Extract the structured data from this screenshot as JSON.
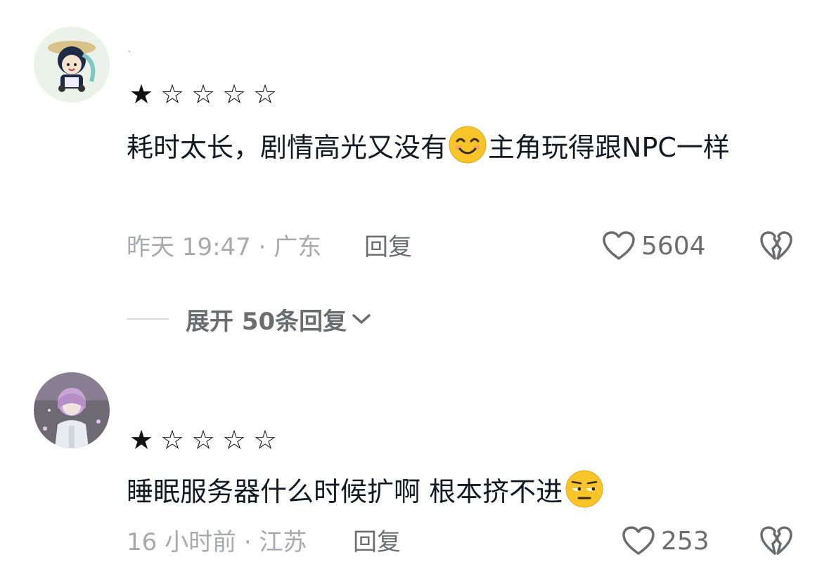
{
  "comments": [
    {
      "username": "、",
      "rating_label": "★☆☆☆☆",
      "rating": 1,
      "rating_max": 5,
      "text_part1": "耗时太长，剧情高光又没有",
      "text_part2": "主角玩得跟NPC一样",
      "emoji_icon": "smiling-face-icon",
      "meta": "昨天 19:47 · 广东",
      "reply_label": "回复",
      "likes": "5604",
      "expand_label": "展开 50条回复"
    },
    {
      "rating_label": "★☆☆☆☆",
      "rating": 1,
      "rating_max": 5,
      "text_part1": "睡眠服务器什么时候扩啊 根本挤不进",
      "text_part2": "",
      "emoji_icon": "unamused-face-icon",
      "meta": "16 小时前 · 江苏",
      "reply_label": "回复",
      "likes": "253"
    }
  ],
  "colors": {
    "text": "#161823",
    "meta": "#a8a9ad",
    "action": "#6b6c70",
    "emoji_yellow": "#f7c52a"
  }
}
